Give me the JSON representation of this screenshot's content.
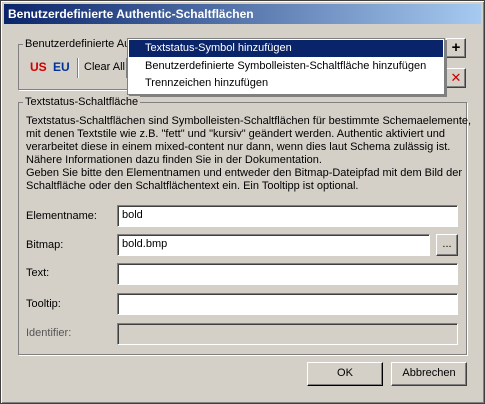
{
  "window": {
    "title": "Benutzerdefinierte Authentic-Schaltflächen"
  },
  "custom_group": {
    "label": "Benutzerdefinierte Au"
  },
  "toolbar": {
    "flag_us": "US",
    "flag_eu": "EU",
    "clear_all": "Clear All",
    "add_icon_glyph": "+",
    "delete_icon_glyph": "✕"
  },
  "menu": {
    "items": [
      "Textstatus-Symbol hinzufügen",
      "Benutzerdefinierte Symbolleisten-Schaltfläche hinzufügen",
      "Trennzeichen hinzufügen"
    ],
    "selected_index": 0
  },
  "textstate_group": {
    "label": "Textstatus-Schaltfläche"
  },
  "description": [
    "Textstatus-Schaltflächen sind Symbolleisten-Schaltflächen für bestimmte Schemaelemente,",
    "mit denen Textstile wie z.B. \"fett\" und \"kursiv\" geändert werden. Authentic aktiviert und",
    "verarbeitet diese in einem mixed-content nur dann, wenn dies laut Schema zulässig ist.",
    "Nähere Informationen dazu finden Sie in der Dokumentation.",
    "Geben Sie bitte den Elementnamen und entweder den Bitmap-Dateipfad mit dem Bild der",
    "Schaltfläche oder den Schaltflächentext ein. Ein Tooltipp ist optional."
  ],
  "form": {
    "element_label": "Elementname:",
    "element_value": "bold",
    "bitmap_label": "Bitmap:",
    "bitmap_value": "bold.bmp",
    "browse_label": "...",
    "text_label": "Text:",
    "text_value": "",
    "tooltip_label": "Tooltip:",
    "tooltip_value": "",
    "identifier_label": "Identifier:",
    "identifier_value": ""
  },
  "footer": {
    "ok_label": "OK",
    "cancel_label": "Abbrechen"
  },
  "colors": {
    "titlebar_start": "#0a246a",
    "titlebar_end": "#a6caf0",
    "flag_us": "#cc0000",
    "flag_eu": "#003399",
    "delete": "#cc0000"
  }
}
